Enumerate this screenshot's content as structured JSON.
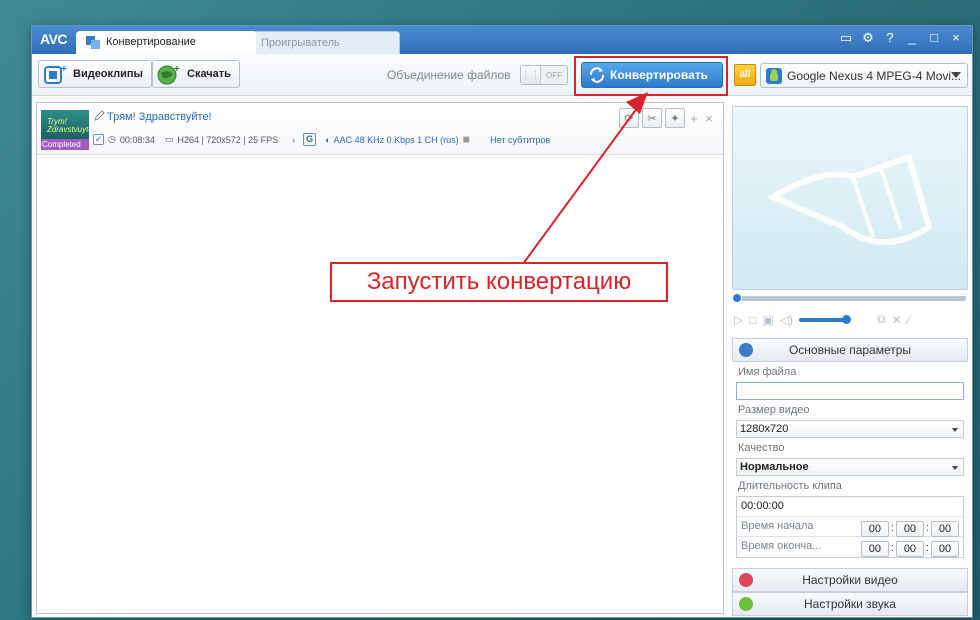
{
  "app": {
    "logo": "AVC",
    "tabs": [
      {
        "label": "Конвертирование",
        "active": true
      },
      {
        "label": "Проигрыватель",
        "active": false
      }
    ],
    "window_controls": [
      "monitor-icon",
      "gear-icon",
      "?",
      "_",
      "□",
      "×"
    ]
  },
  "toolbar": {
    "videoclips_label": "Видеоклипы",
    "download_label": "Скачать",
    "merge_label": "Объединение файлов",
    "merge_toggle_state": "OFF",
    "convert_label": "Конвертировать",
    "all_badge": "all",
    "profile_label": "Google Nexus 4 MPEG-4 Movi..."
  },
  "file": {
    "thumb_title": "Trym! Zdravstvuyte!",
    "status": "Completed",
    "name": "Трям! Здравствуйте!",
    "duration": "00:08:34",
    "video_info": "H264 | 720x572 | 25 FPS",
    "audio_info": "AAC 48 KHz 0 Kbps 1 CH (rus)",
    "subtitles": "Нет субтитров",
    "g_badge": "G"
  },
  "annotation": {
    "text": "Запустить конвертацию"
  },
  "panel": {
    "basic_params": "Основные параметры",
    "file_name_label": "Имя файла",
    "file_name_value": "",
    "video_size_label": "Размер видео",
    "video_size_value": "1280x720",
    "quality_label": "Качество",
    "quality_value": "Нормальное",
    "clip_duration_label": "Длительность клипа",
    "clip_duration_value": "00:00:00",
    "start_time_label": "Время начала",
    "end_time_label": "Время оконча...",
    "start_time": [
      "00",
      "00",
      "00"
    ],
    "end_time": [
      "00",
      "00",
      "00"
    ],
    "video_settings": "Настройки видео",
    "audio_settings": "Настройки звука"
  },
  "colors": {
    "accent": "#2b7acb",
    "annotation": "#d8232a",
    "title_bar": "#3a7cc6"
  }
}
